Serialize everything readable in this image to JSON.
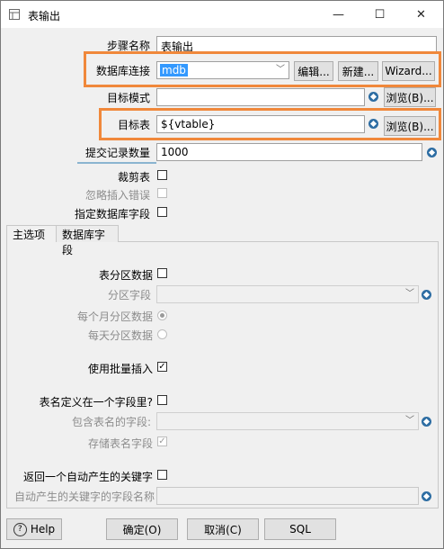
{
  "window": {
    "title": "表输出",
    "minimize": "—",
    "maximize": "☐",
    "close": "✕"
  },
  "form": {
    "step_name_label": "步骤名称",
    "step_name_value": "表输出",
    "connection_label": "数据库连接",
    "connection_value": "mdb",
    "edit_button": "编辑...",
    "new_button": "新建...",
    "wizard_button": "Wizard...",
    "target_schema_label": "目标模式",
    "target_schema_value": "",
    "browse_schema_button": "浏览(B)...",
    "target_table_label": "目标表",
    "target_table_value": "${vtable}",
    "browse_table_button": "浏览(B)...",
    "commit_size_label": "提交记录数量",
    "commit_size_value": "1000",
    "truncate_label": "裁剪表",
    "ignore_errors_label": "忽略插入错误",
    "specify_fields_label": "指定数据库字段"
  },
  "tabs": [
    {
      "label": "主选项"
    },
    {
      "label": "数据库字段"
    }
  ],
  "main_options": {
    "partition_label": "表分区数据",
    "partition_field_label": "分区字段",
    "partition_monthly_label": "每个月分区数据",
    "partition_daily_label": "每天分区数据",
    "batch_insert_label": "使用批量插入",
    "batch_insert_checked": true,
    "table_name_in_field_label": "表名定义在一个字段里?",
    "table_name_field_label": "包含表名的字段:",
    "store_table_name_label": "存储表名字段",
    "store_table_name_checked": true,
    "return_key_label": "返回一个自动产生的关键字",
    "return_key_field_label": "自动产生的关键字的字段名称",
    "return_key_field_value": ""
  },
  "footer": {
    "help_button": "Help",
    "ok_button": "确定(O)",
    "cancel_button": "取消(C)",
    "sql_button": "SQL"
  },
  "colors": {
    "highlight_outline": "#f0883b",
    "selection": "#3399ff",
    "variable_icon": "#2d6da3"
  }
}
